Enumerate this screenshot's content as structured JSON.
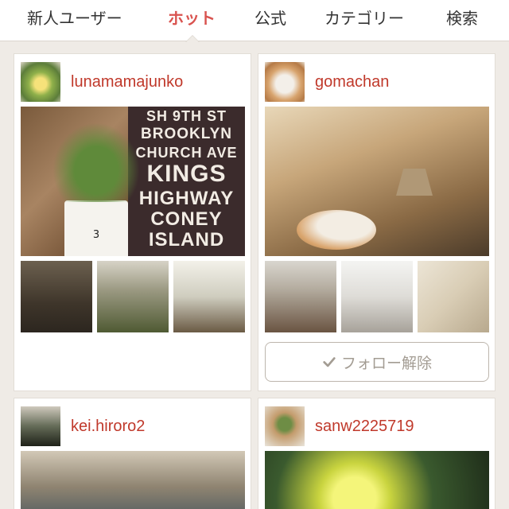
{
  "tabs": [
    {
      "label": "新人ユーザー",
      "active": false
    },
    {
      "label": "ホット",
      "active": true
    },
    {
      "label": "公式",
      "active": false
    },
    {
      "label": "カテゴリー",
      "active": false
    },
    {
      "label": "検索",
      "active": false
    }
  ],
  "posts": [
    {
      "username": "lunamamajunko",
      "avatar": "plant-avatar",
      "main_photo_sign_lines": [
        "SH   9TH ST",
        "BROOKLYN",
        "CHURCH AVE",
        "KINGS",
        "HIGHWAY",
        "CONEY",
        "ISLAND"
      ],
      "pot_number": "3"
    },
    {
      "username": "gomachan",
      "avatar": "cat-avatar",
      "follow_button_label": "フォロー解除",
      "follow_icon": "check-icon"
    },
    {
      "username": "kei.hiroro2",
      "avatar": "room-avatar"
    },
    {
      "username": "sanw2225719",
      "avatar": "succulent-avatar"
    }
  ],
  "colors": {
    "accent": "#d9534f",
    "username": "#c0392b",
    "background": "#efebe6",
    "card": "#ffffff",
    "button_text": "#a39c93"
  }
}
